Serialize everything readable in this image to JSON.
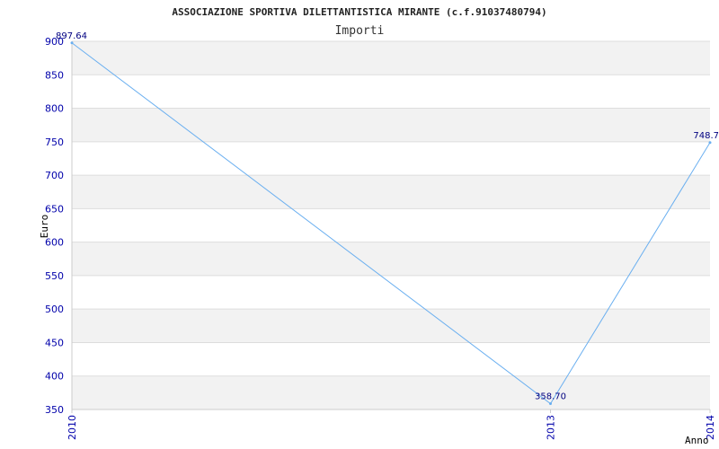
{
  "chart_data": {
    "type": "line",
    "title": "ASSOCIAZIONE SPORTIVA DILETTANTISTICA MIRANTE (c.f.91037480794)",
    "subtitle": "Importi",
    "xlabel": "Anno",
    "ylabel": "Euro",
    "x": [
      "2010",
      "2013",
      "2014"
    ],
    "series": [
      {
        "values": [
          897.64,
          358.7,
          748.7
        ],
        "labels": [
          "897.64",
          "358.70",
          "748.7"
        ]
      }
    ],
    "ylim": [
      350,
      900
    ],
    "yticks": [
      350,
      400,
      450,
      500,
      550,
      600,
      650,
      700,
      750,
      800,
      850,
      900
    ],
    "grid": true,
    "colors": {
      "line": "#6aaff0",
      "band": "#f2f2f2",
      "grid": "#dddddd",
      "tick_text": "#0000aa",
      "data_label": "#000080"
    }
  }
}
